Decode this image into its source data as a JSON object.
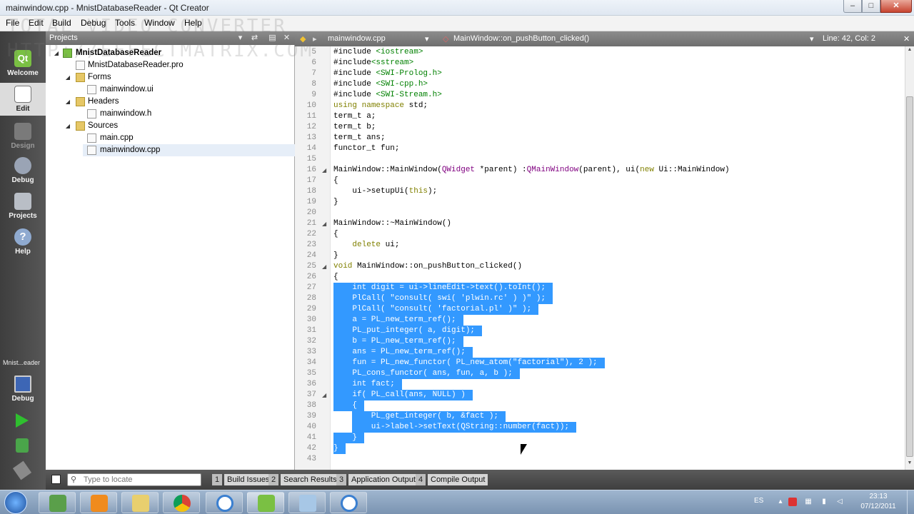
{
  "window": {
    "title": "mainwindow.cpp - MnistDatabaseReader - Qt Creator",
    "min": "‒",
    "max": "□",
    "close": "✕"
  },
  "menu": [
    "File",
    "Edit",
    "Build",
    "Debug",
    "Tools",
    "Window",
    "Help"
  ],
  "modes": [
    {
      "label": "Welcome",
      "icon": "qt-logo-icon"
    },
    {
      "label": "Edit",
      "icon": "edit-document-icon"
    },
    {
      "label": "Design",
      "icon": "design-pencil-icon"
    },
    {
      "label": "Debug",
      "icon": "debug-bug-icon"
    },
    {
      "label": "Projects",
      "icon": "projects-wrench-icon"
    },
    {
      "label": "Help",
      "icon": "help-question-icon"
    }
  ],
  "run_target": {
    "project": "Mnist...eader",
    "config": "Debug"
  },
  "projects_panel": {
    "title": "Projects",
    "tree": [
      {
        "label": "MnistDatabaseReader",
        "level": 0,
        "kind": "project"
      },
      {
        "label": "MnistDatabaseReader.pro",
        "level": 1,
        "kind": "file"
      },
      {
        "label": "Forms",
        "level": 1,
        "kind": "folder"
      },
      {
        "label": "mainwindow.ui",
        "level": 2,
        "kind": "file"
      },
      {
        "label": "Headers",
        "level": 1,
        "kind": "folder"
      },
      {
        "label": "mainwindow.h",
        "level": 2,
        "kind": "file"
      },
      {
        "label": "Sources",
        "level": 1,
        "kind": "folder"
      },
      {
        "label": "main.cpp",
        "level": 2,
        "kind": "file"
      },
      {
        "label": "mainwindow.cpp",
        "level": 2,
        "kind": "file",
        "selected": true
      }
    ]
  },
  "editor": {
    "file": "mainwindow.cpp",
    "function": "MainWindow::on_pushButton_clicked()",
    "position": "Line: 42, Col: 2",
    "lines": [
      {
        "n": "5",
        "t": "#include <iostream>"
      },
      {
        "n": "6",
        "t": "#include<sstream>"
      },
      {
        "n": "7",
        "t": "#include <SWI-Prolog.h>"
      },
      {
        "n": "8",
        "t": "#include <SWI-cpp.h>"
      },
      {
        "n": "9",
        "t": "#include <SWI-Stream.h>"
      },
      {
        "n": "10",
        "t": "using namespace std;"
      },
      {
        "n": "11",
        "t": "term_t a;"
      },
      {
        "n": "12",
        "t": "term_t b;"
      },
      {
        "n": "13",
        "t": "term_t ans;"
      },
      {
        "n": "14",
        "t": "functor_t fun;"
      },
      {
        "n": "15",
        "t": ""
      },
      {
        "n": "16",
        "t": "MainWindow::MainWindow(QWidget *parent) :QMainWindow(parent), ui(new Ui::MainWindow)",
        "fold": true
      },
      {
        "n": "17",
        "t": "{"
      },
      {
        "n": "18",
        "t": "    ui->setupUi(this);"
      },
      {
        "n": "19",
        "t": "}"
      },
      {
        "n": "20",
        "t": ""
      },
      {
        "n": "21",
        "t": "MainWindow::~MainWindow()",
        "fold": true
      },
      {
        "n": "22",
        "t": "{"
      },
      {
        "n": "23",
        "t": "    delete ui;"
      },
      {
        "n": "24",
        "t": "}"
      },
      {
        "n": "25",
        "t": "void MainWindow::on_pushButton_clicked()",
        "fold": true
      },
      {
        "n": "26",
        "t": "{"
      },
      {
        "n": "27",
        "t": "    int digit = ui->lineEdit->text().toInt();",
        "sel": true
      },
      {
        "n": "28",
        "t": "    PlCall( \"consult( swi( 'plwin.rc' ) )\" );",
        "sel": true
      },
      {
        "n": "29",
        "t": "    PlCall( \"consult( 'factorial.pl' )\" );",
        "sel": true
      },
      {
        "n": "30",
        "t": "    a = PL_new_term_ref();",
        "sel": true
      },
      {
        "n": "31",
        "t": "    PL_put_integer( a, digit);",
        "sel": true
      },
      {
        "n": "32",
        "t": "    b = PL_new_term_ref();",
        "sel": true
      },
      {
        "n": "33",
        "t": "    ans = PL_new_term_ref();",
        "sel": true
      },
      {
        "n": "34",
        "t": "    fun = PL_new_functor( PL_new_atom(\"factorial\"), 2 );",
        "sel": true
      },
      {
        "n": "35",
        "t": "    PL_cons_functor( ans, fun, a, b );",
        "sel": true
      },
      {
        "n": "36",
        "t": "    int fact;",
        "sel": true
      },
      {
        "n": "37",
        "t": "    if( PL_call(ans, NULL) )",
        "sel": true,
        "fold": true
      },
      {
        "n": "38",
        "t": "    {",
        "sel": true
      },
      {
        "n": "39",
        "t": "        PL_get_integer( b, &fact );",
        "sel": true
      },
      {
        "n": "40",
        "t": "        ui->label->setText(QString::number(fact));",
        "sel": true
      },
      {
        "n": "41",
        "t": "    }",
        "sel": true
      },
      {
        "n": "42",
        "t": "}",
        "sel": true
      },
      {
        "n": "43",
        "t": ""
      }
    ]
  },
  "output_bar": {
    "locate_placeholder": "Type to locate",
    "tabs": [
      {
        "n": "1",
        "label": "Build Issues"
      },
      {
        "n": "2",
        "label": "Search Results"
      },
      {
        "n": "3",
        "label": "Application Output"
      },
      {
        "n": "4",
        "label": "Compile Output"
      }
    ]
  },
  "taskbar": {
    "lang": "ES",
    "time": "23:13",
    "date": "07/12/2011"
  },
  "watermark": [
    "TOTAL VIDEO CONVERTER",
    "HTTP://EFFECTMATRIX.COM"
  ],
  "colors": {
    "selection": "#3399ff",
    "keyword": "#808000",
    "string": "#008000",
    "class": "#800080"
  }
}
